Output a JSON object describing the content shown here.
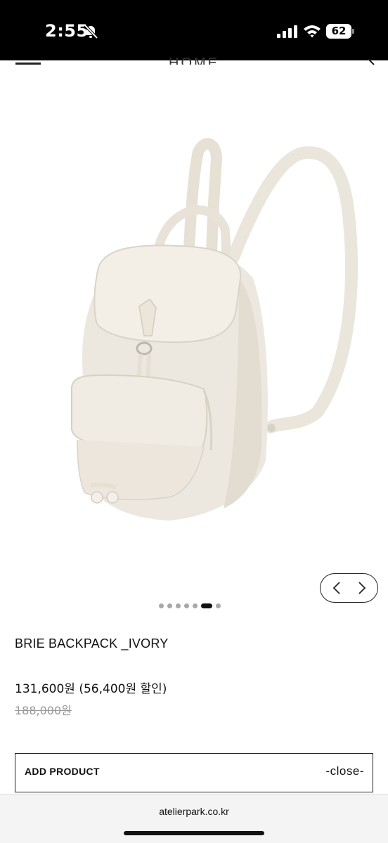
{
  "status_bar": {
    "time": "2:55",
    "battery": "62",
    "icons": [
      "bell-slash-icon",
      "signal-icon",
      "wifi-icon",
      "battery-icon"
    ]
  },
  "header": {
    "title": "HOME",
    "icons": [
      "menu-icon",
      "search-icon"
    ]
  },
  "product": {
    "image_icon": "ivory-backpack-photo",
    "name": "BRIE BACKPACK _IVORY",
    "sale_price": "131,600원 (56,400원 할인)",
    "original_price": "188,000원"
  },
  "slider": {
    "dot_count": 7,
    "active_index": 5,
    "icons": [
      "chevron-left-icon",
      "chevron-right-icon"
    ]
  },
  "add_product": {
    "title": "ADD PRODUCT",
    "close_label": "-close-"
  },
  "browser": {
    "url": "atelierpark.co.kr"
  },
  "colors": {
    "status_bar": "#000000",
    "background": "#ffffff",
    "text": "#111111",
    "muted": "#999999",
    "dot_inactive": "#a8a8a8",
    "bag": "#ece7de"
  }
}
